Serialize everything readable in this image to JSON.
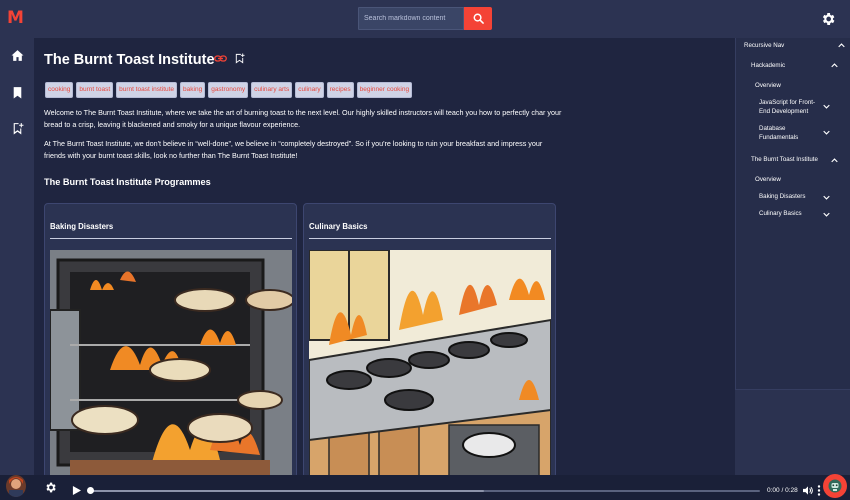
{
  "app": {
    "logo": "M"
  },
  "search": {
    "placeholder": "Search markdown content"
  },
  "page": {
    "title": "The Burnt Toast Institute",
    "tags": [
      "cooking",
      "burnt toast",
      "burnt toast institute",
      "baking",
      "gastronomy",
      "culinary arts",
      "culinary",
      "recipes",
      "beginner cooking"
    ],
    "intro_1": "Welcome to The Burnt Toast Institute, where we take the art of burning toast to the next level. Our highly skilled instructors will teach you how to perfectly char your bread to a crisp, leaving it blackened and smoky for a unique flavour experience.",
    "intro_2": "At The Burnt Toast Institute, we don't believe in “well-done”, we believe in “completely destroyed”. So if you're looking to ruin your breakfast and impress your friends with your burnt toast skills, look no further than The Burnt Toast Institute!",
    "section_title": "The Burnt Toast Institute Programmes",
    "cards": [
      {
        "title": "Baking Disasters"
      },
      {
        "title": "Culinary Basics"
      }
    ]
  },
  "right_nav": {
    "root": "Recursive Nav",
    "hackademic": "Hackademic",
    "overview_1": "Overview",
    "js_frontend": "JavaScript for Front-End Development",
    "db_fundamentals": "Database Fundamentals",
    "burnt_toast": "The Burnt Toast Institute",
    "overview_2": "Overview",
    "baking_disasters": "Baking Disasters",
    "culinary_basics": "Culinary Basics"
  },
  "player": {
    "time": "0:00 / 0:28",
    "progress": 0.0,
    "buffered": 0.59
  },
  "colors": {
    "accent": "#f44336",
    "background": "#1f2540",
    "panel": "#2b3352",
    "tag_bg": "#cfd3e6",
    "tag_text": "#e8493e"
  },
  "icons": [
    "home-icon",
    "bookmark-icon",
    "bookmark-add-icon",
    "search-icon",
    "gear-icon",
    "link-icon",
    "play-icon",
    "volume-icon",
    "more-vert-icon",
    "robot-icon",
    "chevron-up-icon",
    "chevron-down-icon"
  ]
}
